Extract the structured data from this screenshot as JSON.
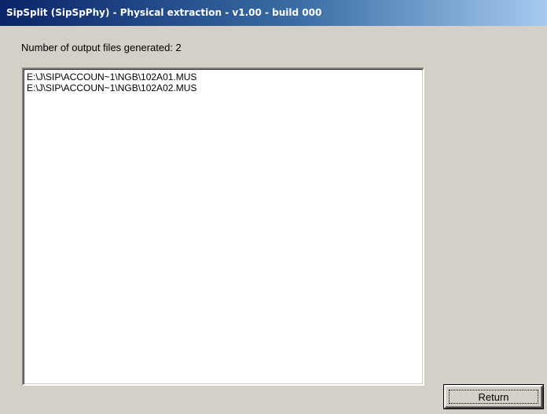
{
  "window": {
    "title": "SipSplit (SipSpPhy) - Physical extraction - v1.00 - build 000"
  },
  "status": {
    "label": "Number of output files generated: 2"
  },
  "output_files": [
    "E:\\J\\SIP\\ACCOUN~1\\NGB\\102A01.MUS",
    "E:\\J\\SIP\\ACCOUN~1\\NGB\\102A02.MUS"
  ],
  "buttons": {
    "return_label": "Return"
  },
  "colors": {
    "titlebar_start": "#0a246a",
    "titlebar_end": "#a6caf0",
    "window_bg": "#d4d0c8",
    "list_bg": "#ffffff"
  }
}
